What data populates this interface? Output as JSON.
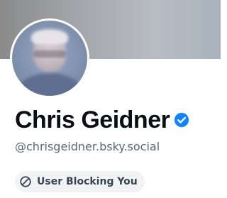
{
  "profile": {
    "display_name": "Chris Geidner",
    "handle": "@chrisgeidner.bsky.social",
    "verified_icon": "verified-check-icon",
    "blocking_status": {
      "label": "User Blocking You",
      "icon": "block-icon"
    }
  },
  "colors": {
    "verified": "#1083fe",
    "name_text": "#0b0f14",
    "handle_text": "#5b6675",
    "pill_background": "#f1f3f5",
    "pill_text": "#3a4553"
  }
}
